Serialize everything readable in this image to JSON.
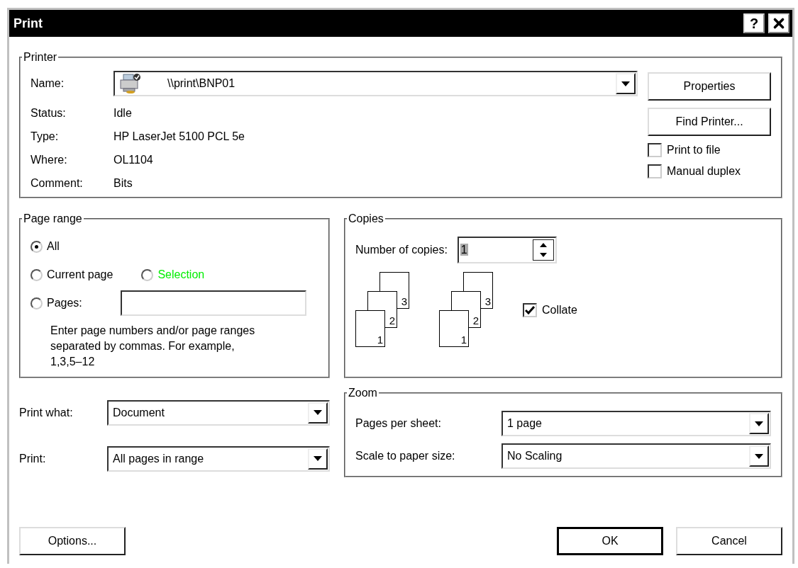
{
  "window": {
    "title": "Print",
    "help_button": "?"
  },
  "printer": {
    "legend": "Printer",
    "name_label": "Name:",
    "name_value": "\\\\print\\BNP01",
    "info": [
      {
        "label": "Status:",
        "value": "Idle"
      },
      {
        "label": "Type:",
        "value": "HP LaserJet 5100 PCL 5e"
      },
      {
        "label": "Where:",
        "value": "OL1104"
      },
      {
        "label": "Comment:",
        "value": "Bits"
      }
    ],
    "buttons": [
      "Properties",
      "Find Printer..."
    ],
    "checkboxes": [
      {
        "label": "Print to file",
        "checked": false
      },
      {
        "label": "Manual duplex",
        "checked": false
      }
    ]
  },
  "page_range": {
    "legend": "Page range",
    "rows": [
      [
        {
          "kind": "radio",
          "label": "All",
          "selected": true
        }
      ],
      [
        {
          "kind": "radio",
          "label": "Current page",
          "selected": false
        },
        {
          "kind": "radio",
          "label": "Selection",
          "selected": false,
          "color": "#00ee00"
        }
      ],
      [
        {
          "kind": "radio_field",
          "label": "Pages:",
          "selected": false
        }
      ]
    ],
    "hint": "Enter page numbers and/or page ranges separated by commas.  For example, 1,3,5–12"
  },
  "copies": {
    "legend": "Copies",
    "label": "Number of copies:",
    "value": "1",
    "stacks": [
      [
        "1",
        "2",
        "3"
      ],
      [
        "1",
        "2",
        "3"
      ]
    ],
    "collate": {
      "label": "Collate",
      "checked": true
    }
  },
  "print_options": [
    {
      "label": "Print what:",
      "value": "Document"
    },
    {
      "label": "Print:",
      "value": "All pages in range"
    }
  ],
  "zoom": {
    "legend": "Zoom",
    "rows": [
      {
        "label": "Pages per sheet:",
        "value": "1 page"
      },
      {
        "label": "Scale to paper size:",
        "value": "No Scaling"
      }
    ]
  },
  "buttons": [
    {
      "kind": "secondary",
      "label": "Options..."
    },
    {
      "kind": "default",
      "label": "OK"
    },
    {
      "kind": "secondary",
      "label": "Cancel"
    }
  ]
}
